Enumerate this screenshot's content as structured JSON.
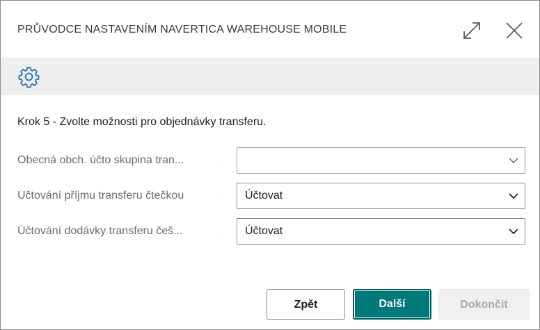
{
  "dialog": {
    "title": "PRŮVODCE NASTAVENÍM NAVERTICA WAREHOUSE MOBILE",
    "expand_icon": "expand-icon",
    "close_icon": "close-icon"
  },
  "toolbar": {
    "icon": "gear-icon"
  },
  "step": {
    "text": "Krok 5 - Zvolte možnosti pro objednávky transferu."
  },
  "fields": [
    {
      "label": "Obecná obch. účto skupina tran...",
      "value": ""
    },
    {
      "label": "Účtování příjmu transferu čtečkou",
      "value": "Účtovat"
    },
    {
      "label": "Účtování dodávky transferu češ...",
      "value": "Účtovat"
    }
  ],
  "buttons": {
    "back": "Zpět",
    "next": "Další",
    "finish": "Dokončit"
  },
  "colors": {
    "accent": "#00797a",
    "toolbar_bg": "#eeeeee",
    "gear": "#2a6fb0"
  }
}
